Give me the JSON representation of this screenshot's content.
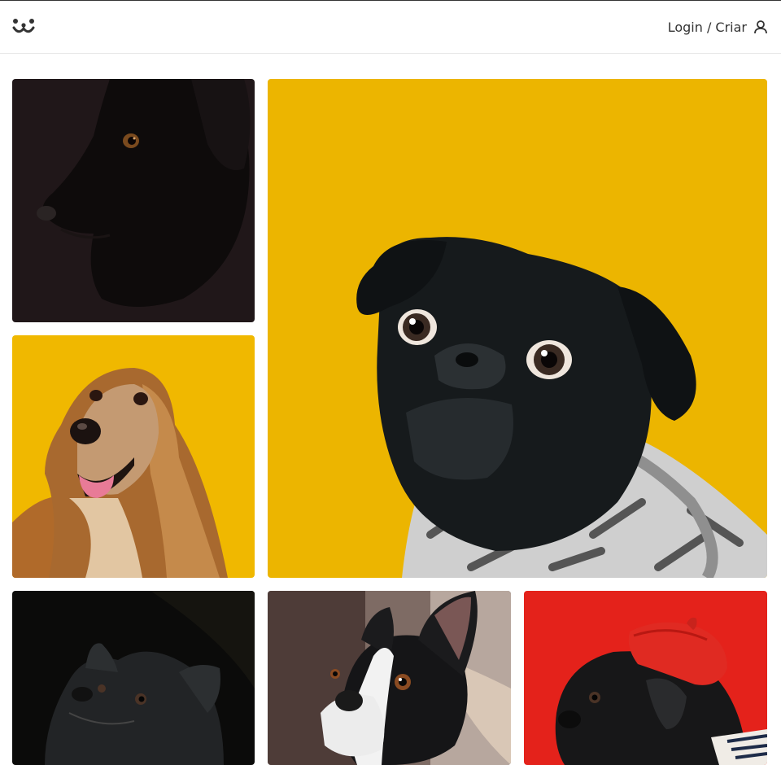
{
  "header": {
    "logo_icon": "dog-face-logo-icon",
    "login_label": "Login / Criar",
    "user_icon": "user-icon"
  },
  "photos": [
    {
      "name": "photo-black-dog-profile",
      "background": "#201719"
    },
    {
      "name": "photo-afghan-hound-smiling",
      "background": "#f0b800"
    },
    {
      "name": "photo-black-pug-sweater",
      "background": "#ecb500"
    },
    {
      "name": "photo-black-fluffy-dog",
      "background": "#0b0b0a"
    },
    {
      "name": "photo-boston-terrier",
      "background": "#7e6b64"
    },
    {
      "name": "photo-pug-red-beret",
      "background": "#e4221b"
    }
  ],
  "colors": {
    "text": "#333333",
    "header_border": "#e6e6e6"
  }
}
